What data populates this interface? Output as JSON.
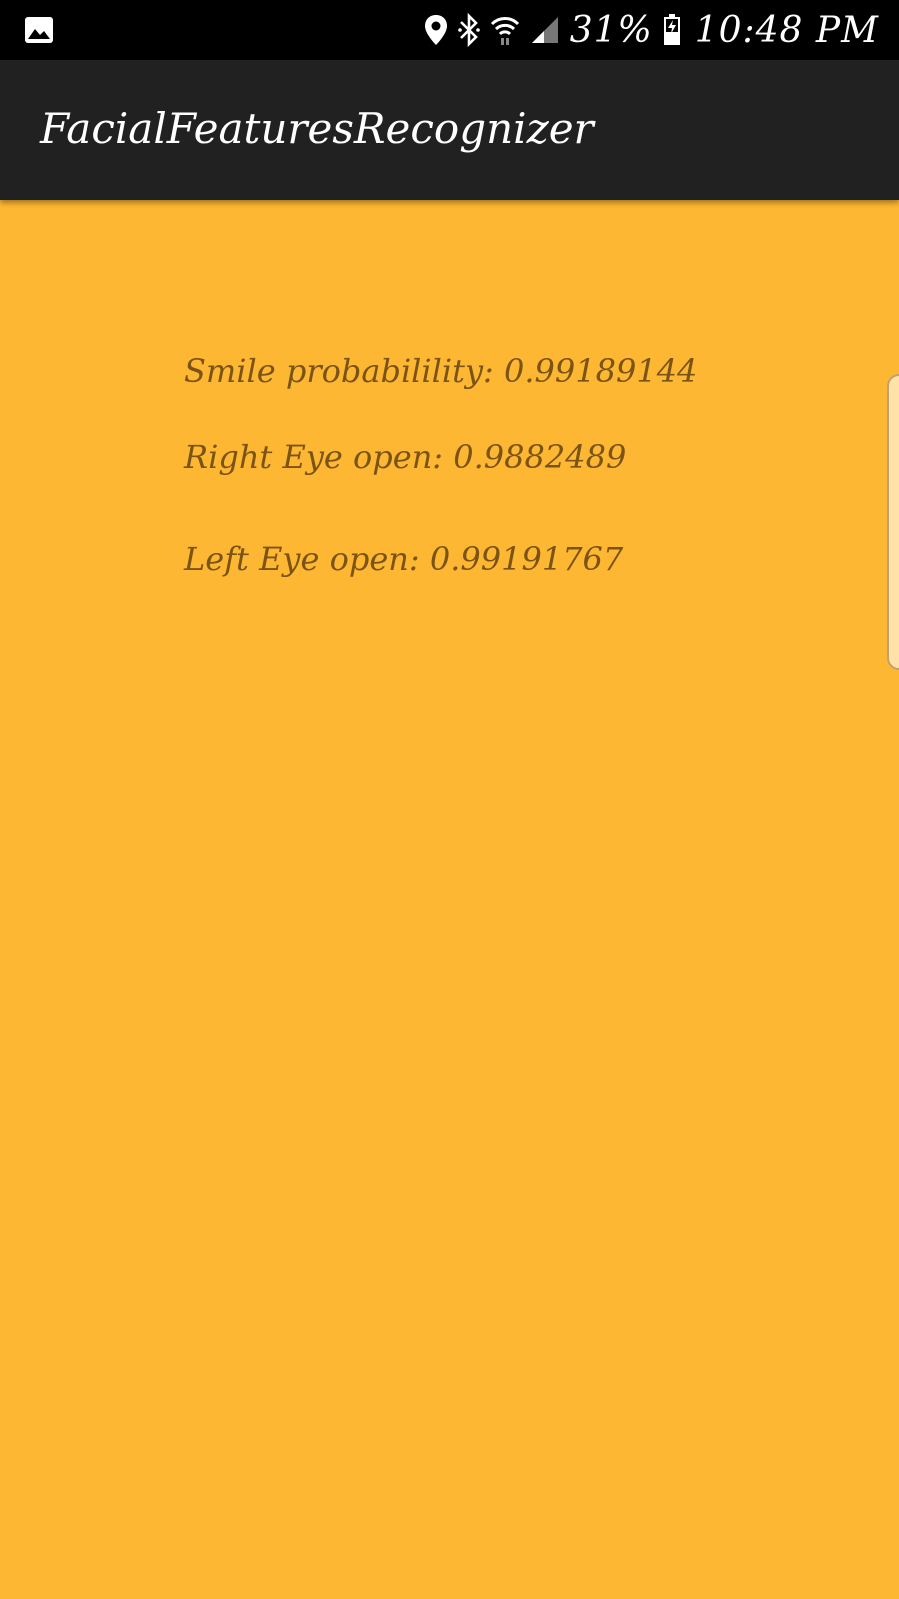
{
  "status_bar": {
    "battery_percent": "31%",
    "time": "10:48 PM",
    "icons": [
      "image-icon",
      "location-icon",
      "bluetooth-icon",
      "wifi-icon",
      "cell-signal-icon",
      "battery-charging-icon"
    ]
  },
  "app_bar": {
    "title": "FacialFeaturesRecognizer"
  },
  "results": {
    "smile": "Smile probabilility: 0.99189144",
    "right_eye": "Right Eye open: 0.9882489",
    "left_eye": "Left Eye open: 0.99191767"
  },
  "colors": {
    "background": "#FEB733",
    "app_bar": "#212121",
    "status_bar": "#000000",
    "text": "#7A5414",
    "edge_handle": "#FFE2A8"
  }
}
